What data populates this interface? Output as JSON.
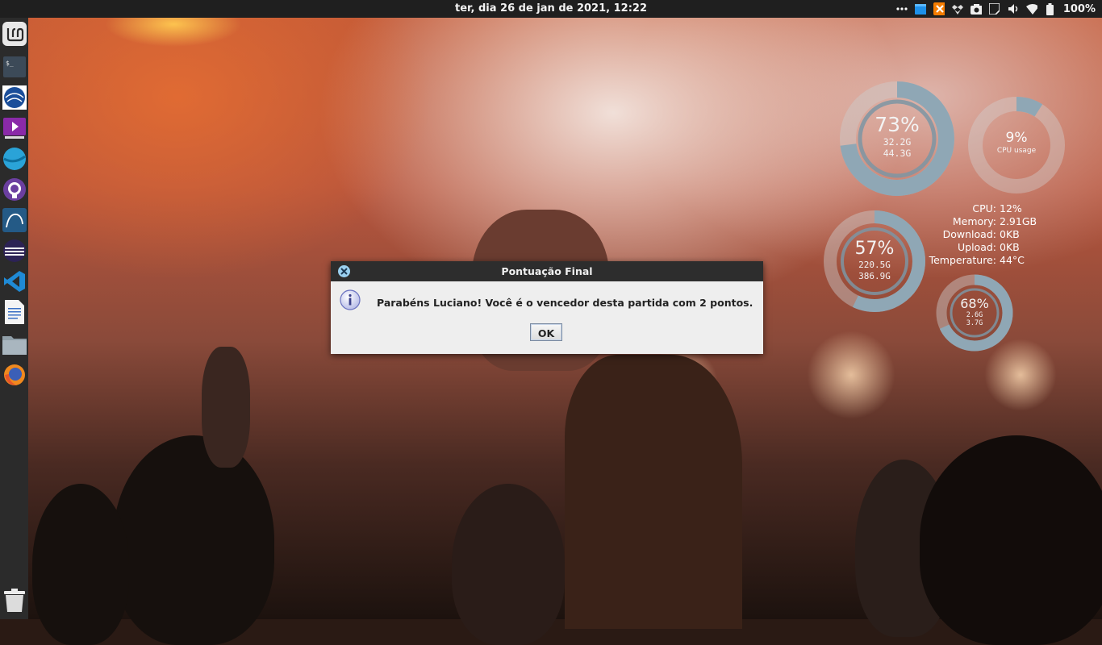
{
  "top_panel": {
    "clock": "ter, dia 26 de jan de 2021, 12:22",
    "battery": "100%",
    "tray_icons": [
      "more-icon",
      "window-icon",
      "xampp-icon",
      "dropbox-icon",
      "screenshot-icon",
      "notes-icon",
      "volume-icon",
      "wifi-icon",
      "battery-icon"
    ]
  },
  "dock": {
    "items": [
      "linux-mint-icon",
      "terminal-icon",
      "browser-globe-icon",
      "media-player-icon",
      "web-browser-icon",
      "github-icon",
      "mysql-workbench-icon",
      "eclipse-icon",
      "vscode-icon",
      "text-editor-icon",
      "files-icon",
      "firefox-icon"
    ],
    "trash": "trash-icon"
  },
  "conky": {
    "disk1": {
      "percent": "73%",
      "used": "32.2G",
      "total": "44.3G",
      "fraction": 0.73
    },
    "cpu": {
      "percent": "9%",
      "label": "CPU usage",
      "fraction": 0.09
    },
    "disk2": {
      "percent": "57%",
      "used": "220.5G",
      "total": "386.9G",
      "fraction": 0.57
    },
    "mem": {
      "percent": "68%",
      "used": "2.6G",
      "total": "3.7G",
      "fraction": 0.68
    },
    "stats": [
      {
        "label": "CPU:",
        "value": "12%"
      },
      {
        "label": "Memory:",
        "value": "2.91GB"
      },
      {
        "label": "Download:",
        "value": "0KB"
      },
      {
        "label": "Upload:",
        "value": "0KB"
      },
      {
        "label": "Temperature:",
        "value": "44°C"
      }
    ]
  },
  "dialog": {
    "title": "Pontuação Final",
    "message": "Parabéns Luciano! Você é o vencedor desta partida com 2 pontos.",
    "ok_label": "OK"
  },
  "colors": {
    "panel": "#1f1f1f",
    "dock": "#2b2b2b",
    "ring_track": "rgba(200,200,200,0.45)",
    "ring_fill": "#8fa7b5",
    "dialog_bg": "#eeeeee"
  }
}
